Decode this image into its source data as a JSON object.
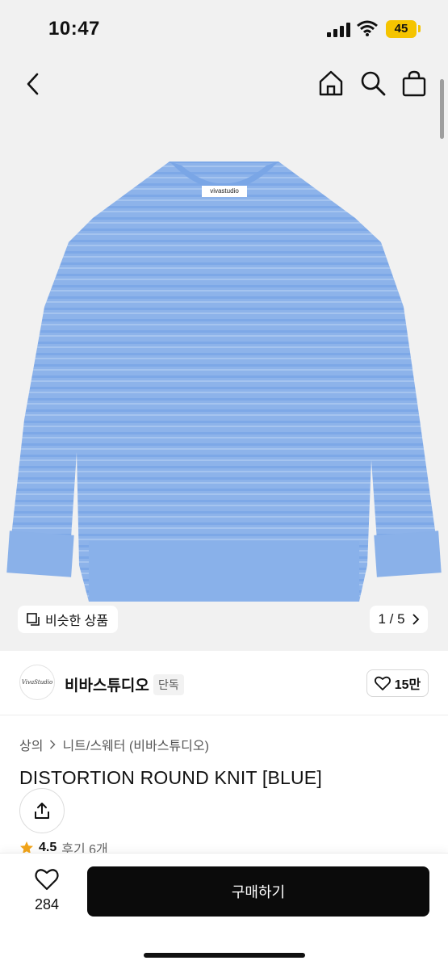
{
  "status_bar": {
    "time": "10:47",
    "battery": "45"
  },
  "icons": {
    "back": "chevron-left-icon",
    "home": "home-icon",
    "search": "search-icon",
    "bag": "shopping-bag-icon"
  },
  "gallery": {
    "garment_tag": "vivastudio",
    "similar_label": "비슷한 상품",
    "pager": "1 / 5",
    "sweater_color": "#8eb4ea"
  },
  "seller": {
    "logo_text": "VivaStudio",
    "name": "비바스튜디오",
    "badge": "단독",
    "likes": "15만"
  },
  "product": {
    "breadcrumb": [
      "상의",
      "니트/스웨터 (비바스튜디오)"
    ],
    "title": "DISTORTION ROUND KNIT [BLUE]",
    "rating": "4.5",
    "reviews": "후기 6개"
  },
  "bottom_bar": {
    "wish_count": "284",
    "buy_label": "구매하기"
  }
}
